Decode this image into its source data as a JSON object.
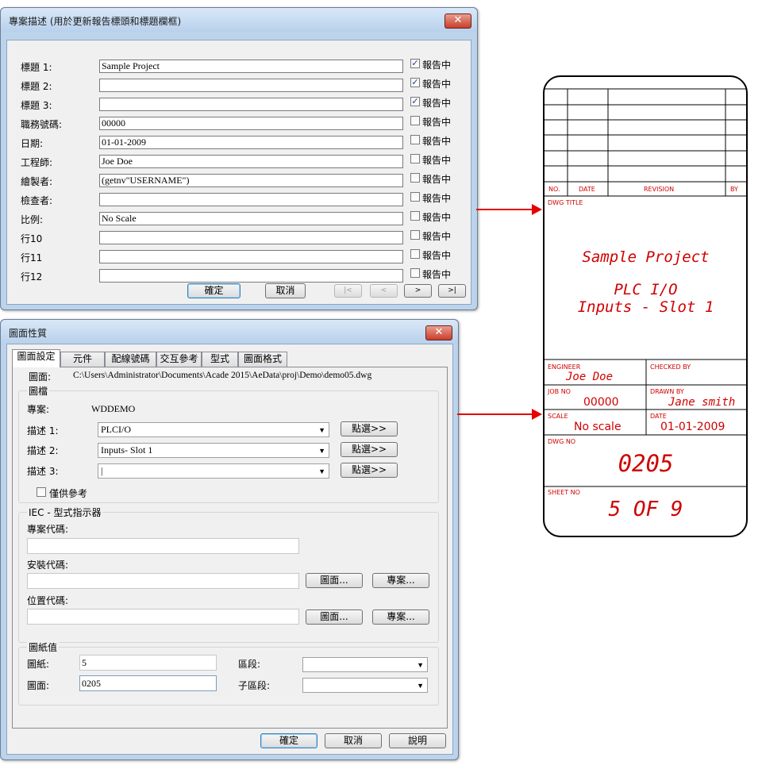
{
  "dlg1": {
    "title": "專案描述 (用於更新報告標頭和標題欄框)",
    "close": "✕",
    "rows": [
      {
        "label": "標題 1:",
        "value": "Sample Project",
        "checked": true
      },
      {
        "label": "標題 2:",
        "value": "",
        "checked": true
      },
      {
        "label": "標題 3:",
        "value": "",
        "checked": true
      },
      {
        "label": "職務號碼:",
        "value": "00000",
        "checked": false
      },
      {
        "label": "日期:",
        "value": "01-01-2009",
        "checked": false
      },
      {
        "label": "工程師:",
        "value": "Joe Doe",
        "checked": false
      },
      {
        "label": "繪製者:",
        "value": "(getnv\"USERNAME\")",
        "checked": false
      },
      {
        "label": "檢查者:",
        "value": "",
        "checked": false
      },
      {
        "label": "比例:",
        "value": "No Scale",
        "checked": false
      },
      {
        "label": "行10",
        "value": "",
        "checked": false
      },
      {
        "label": "行11",
        "value": "",
        "checked": false
      },
      {
        "label": "行12",
        "value": "",
        "checked": false
      }
    ],
    "report_label": "報告中",
    "ok": "確定",
    "cancel": "取消",
    "nav_first": "|<",
    "nav_prev": "<",
    "nav_next": ">",
    "nav_last": ">|"
  },
  "dlg2": {
    "title": "圖面性質",
    "close": "✕",
    "tabs": [
      "圖面設定",
      "元件",
      "配線號碼",
      "交互參考",
      "型式",
      "圖面格式"
    ],
    "active_tab": 0,
    "drawing_label": "圖面:",
    "drawing_path": "C:\\Users\\Administrator\\Documents\\Acade 2015\\AeData\\proj\\Demo\\demo05.dwg",
    "group_drawing": "圖檔",
    "project_label": "專案:",
    "project_value": "WDDEMO",
    "desc1_label": "描述 1:",
    "desc1_value": "PLCI/O",
    "desc2_label": "描述 2:",
    "desc2_value": "Inputs- Slot 1",
    "desc3_label": "描述 3:",
    "desc3_value": "|",
    "pick_label": "點選>>",
    "ref_only": "僅供參考",
    "group_iec": "IEC - 型式指示器",
    "proj_code_label": "專案代碼:",
    "install_code_label": "安裝代碼:",
    "location_code_label": "位置代碼:",
    "drawing_btn": "圖面...",
    "project_btn": "專案...",
    "group_sheet": "圖紙值",
    "sheet_label": "圖紙:",
    "sheet_value": "5",
    "dwg_label": "圖面:",
    "dwg_value": "0205",
    "section_label": "區段:",
    "subsection_label": "子區段:",
    "ok": "確定",
    "cancel": "取消",
    "help": "說明"
  },
  "titleblock": {
    "rev_no": "NO.",
    "rev_date": "DATE",
    "rev_revision": "REVISION",
    "rev_by": "BY",
    "dwg_title_label": "DWG TITLE",
    "title1": "Sample Project",
    "title2": "PLC I/O",
    "title3": "Inputs - Slot 1",
    "engineer_label": "ENGINEER",
    "engineer_value": "Joe Doe",
    "checked_label": "CHECKED BY",
    "jobno_label": "JOB NO",
    "jobno_value": "00000",
    "drawnby_label": "DRAWN BY",
    "drawnby_value": "Jane smith",
    "scale_label": "SCALE",
    "scale_value": "No scale",
    "date_label": "DATE",
    "date_value": "01-01-2009",
    "dwgno_label": "DWG NO",
    "dwgno_value": "0205",
    "sheetno_label": "SHEET NO",
    "sheetno_value": "5 OF 9"
  },
  "colors": {
    "arrow": "#e60000",
    "titleblock_text": "#d00000"
  }
}
